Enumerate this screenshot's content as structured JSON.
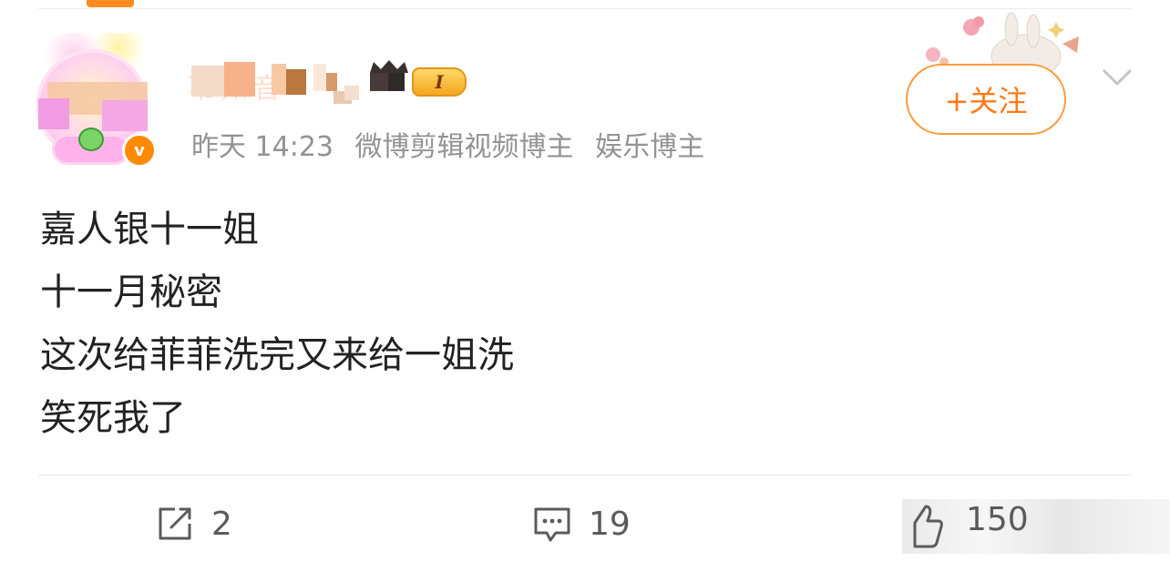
{
  "author": {
    "name": "苇如音",
    "level_badge": "I",
    "verified": "v"
  },
  "meta": {
    "time": "昨天 14:23",
    "tag_1": "微博剪辑视频博主",
    "tag_2": "娱乐博主"
  },
  "follow": {
    "label": "+关注"
  },
  "post": {
    "lines": [
      "嘉人银十一姐",
      "十一月秘密",
      "这次给菲菲洗完又来给一姐洗",
      "笑死我了"
    ]
  },
  "actions": {
    "repost_count": "2",
    "comment_count": "19",
    "like_count": "150"
  },
  "colors": {
    "accent": "#ff8a1f",
    "follow_text": "#ff7a1a",
    "meta_text": "#939393",
    "body_text": "#222222"
  },
  "icons": [
    "verified-icon",
    "crown-icon",
    "chevron-down-icon",
    "repost-icon",
    "comment-icon",
    "like-icon"
  ]
}
